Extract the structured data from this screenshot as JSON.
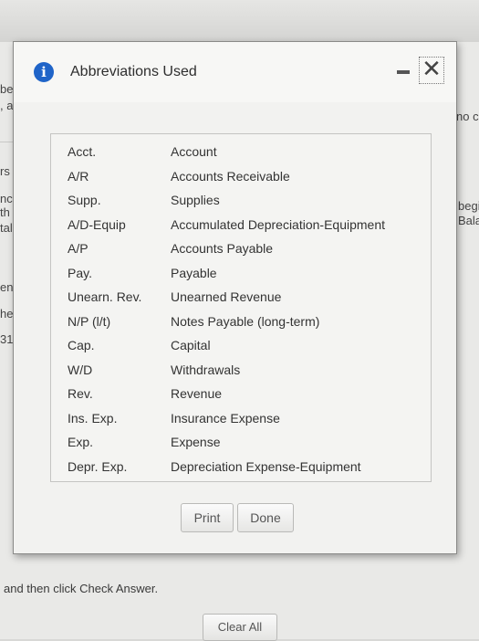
{
  "background": {
    "left_fragments": [
      "be",
      ", a",
      "rs",
      "nc",
      "th",
      "tal",
      "en",
      "he",
      "31"
    ],
    "right_fragments": [
      "no c",
      "begin",
      "Bala"
    ],
    "instruction": "and then click Check Answer.",
    "clear_all_label": "Clear All"
  },
  "dialog": {
    "title": "Abbreviations Used",
    "icon": "info-icon",
    "rows": [
      {
        "abbr": "Acct.",
        "full": "Account"
      },
      {
        "abbr": "A/R",
        "full": "Accounts Receivable"
      },
      {
        "abbr": "Supp.",
        "full": "Supplies"
      },
      {
        "abbr": "A/D-Equip",
        "full": "Accumulated Depreciation-Equipment"
      },
      {
        "abbr": "A/P",
        "full": "Accounts Payable"
      },
      {
        "abbr": "Pay.",
        "full": "Payable"
      },
      {
        "abbr": "Unearn. Rev.",
        "full": "Unearned Revenue"
      },
      {
        "abbr": "N/P (l/t)",
        "full": "Notes Payable (long-term)"
      },
      {
        "abbr": "Cap.",
        "full": "Capital"
      },
      {
        "abbr": "W/D",
        "full": "Withdrawals"
      },
      {
        "abbr": "Rev.",
        "full": "Revenue"
      },
      {
        "abbr": "Ins. Exp.",
        "full": "Insurance Expense"
      },
      {
        "abbr": "Exp.",
        "full": "Expense"
      },
      {
        "abbr": "Depr. Exp.",
        "full": "Depreciation Expense-Equipment"
      }
    ],
    "print_label": "Print",
    "done_label": "Done"
  }
}
